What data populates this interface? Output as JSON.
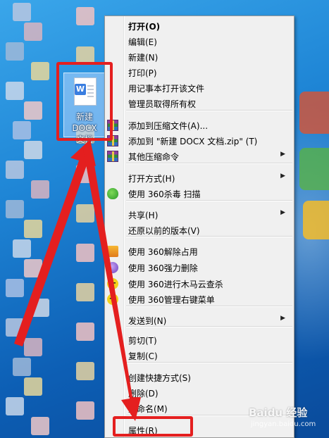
{
  "desktop": {
    "file_icon": {
      "badge": "W",
      "label_line1": "新建 DOCX",
      "label_line2": "文档"
    }
  },
  "context_menu": {
    "items": [
      {
        "label": "打开(O)",
        "bold": true
      },
      {
        "label": "编辑(E)"
      },
      {
        "label": "新建(N)"
      },
      {
        "label": "打印(P)"
      },
      {
        "label": "用记事本打开该文件"
      },
      {
        "label": "管理员取得所有权"
      },
      {
        "label": "添加到压缩文件(A)...",
        "icon": "winrar-icon"
      },
      {
        "label": "添加到 \"新建 DOCX 文档.zip\" (T)",
        "icon": "winrar-icon"
      },
      {
        "label": "其他压缩命令",
        "icon": "winrar-icon",
        "submenu": true
      },
      {
        "label": "打开方式(H)",
        "submenu": true
      },
      {
        "label": "使用 360杀毒 扫描",
        "icon": "360-antivirus-icon"
      },
      {
        "label": "共享(H)",
        "submenu": true
      },
      {
        "label": "还原以前的版本(V)"
      },
      {
        "label": "使用 360解除占用",
        "icon": "360-unlock-icon"
      },
      {
        "label": "使用 360强力删除",
        "icon": "360-shred-icon"
      },
      {
        "label": "使用 360进行木马云查杀",
        "icon": "360-cloud-scan-icon"
      },
      {
        "label": "使用 360管理右键菜单",
        "icon": "360-menu-manager-icon"
      },
      {
        "label": "发送到(N)",
        "submenu": true
      },
      {
        "label": "剪切(T)"
      },
      {
        "label": "复制(C)"
      },
      {
        "label": "创建快捷方式(S)"
      },
      {
        "label": "删除(D)"
      },
      {
        "label": "重命名(M)"
      },
      {
        "label": "属性(R)"
      }
    ],
    "submenu_arrow": "▶"
  },
  "annotations": {
    "highlight_color": "#e41f1f",
    "highlights": [
      "file-icon",
      "properties-menu-item"
    ]
  },
  "watermark": {
    "text": "Baidu 经验",
    "subtext": "jingyan.baidu.com"
  }
}
